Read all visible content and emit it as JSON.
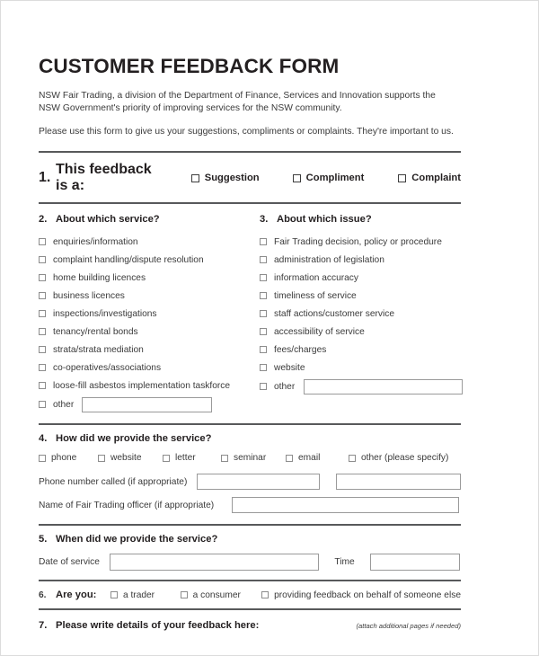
{
  "document": {
    "title": "CUSTOMER FEEDBACK FORM",
    "intro_paragraph_1": "NSW Fair Trading, a division of the Department of Finance, Services and Innovation supports the NSW Government's priority of improving services for the NSW community.",
    "intro_paragraph_2": "Please use this form to give us your suggestions, compliments or complaints. They're important to us."
  },
  "q1": {
    "number": "1.",
    "label": "This feedback is a:",
    "options": [
      {
        "label": "Suggestion"
      },
      {
        "label": "Compliment"
      },
      {
        "label": "Complaint"
      }
    ]
  },
  "q2": {
    "number": "2.",
    "label": "About which service?",
    "options": [
      {
        "label": "enquiries/information"
      },
      {
        "label": "complaint handling/dispute resolution"
      },
      {
        "label": "home building licences"
      },
      {
        "label": "business licences"
      },
      {
        "label": "inspections/investigations"
      },
      {
        "label": "tenancy/rental bonds"
      },
      {
        "label": "strata/strata mediation"
      },
      {
        "label": "co-operatives/associations"
      },
      {
        "label": "loose-fill asbestos implementation taskforce"
      }
    ],
    "other_label": "other",
    "other_value": "",
    "other_placeholder": ""
  },
  "q3": {
    "number": "3.",
    "label": "About which issue?",
    "options": [
      {
        "label": "Fair Trading decision, policy or procedure"
      },
      {
        "label": "administration of legislation"
      },
      {
        "label": "information accuracy"
      },
      {
        "label": "timeliness of service"
      },
      {
        "label": "staff actions/customer service"
      },
      {
        "label": "accessibility of service"
      },
      {
        "label": "fees/charges"
      },
      {
        "label": "website"
      }
    ],
    "other_label": "other",
    "other_value": "",
    "other_placeholder": ""
  },
  "q4": {
    "number": "4.",
    "label": "How did we provide the service?",
    "options": [
      {
        "label": "phone"
      },
      {
        "label": "website"
      },
      {
        "label": "letter"
      },
      {
        "label": "seminar"
      },
      {
        "label": "email"
      },
      {
        "label": "other (please specify)"
      }
    ],
    "phone_label": "Phone number called (if appropriate)",
    "phone_value_1": "",
    "phone_value_2": "",
    "officer_label": "Name of Fair Trading officer (if appropriate)",
    "officer_value": ""
  },
  "q5": {
    "number": "5.",
    "label": "When did we provide the service?",
    "date_label": "Date of service",
    "date_value": "",
    "time_label": "Time",
    "time_value": ""
  },
  "q6": {
    "number": "6.",
    "label": "Are you:",
    "options": [
      {
        "label": "a trader"
      },
      {
        "label": "a consumer"
      },
      {
        "label": "providing feedback on behalf of someone else"
      }
    ]
  },
  "q7": {
    "number": "7.",
    "label": "Please write details of your feedback here:",
    "note": "(attach additional pages if needed)"
  }
}
